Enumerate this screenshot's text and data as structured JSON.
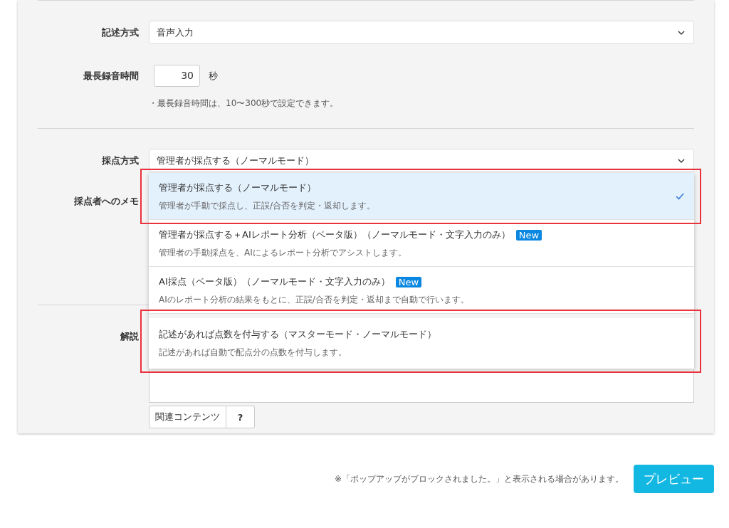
{
  "answer_format": {
    "label": "記述方式",
    "value": "音声入力"
  },
  "max_recording": {
    "label": "最長録音時間",
    "value": "30",
    "unit": "秒",
    "note": "・最長録音時間は、10〜300秒で設定できます。"
  },
  "grading_method": {
    "label": "採点方式",
    "value": "管理者が採点する（ノーマルモード）",
    "expanded": true,
    "options": [
      {
        "title": "管理者が採点する（ノーマルモード）",
        "description": "管理者が手動で採点し、正誤/合否を判定・返却します。",
        "selected": true,
        "highlighted": true
      },
      {
        "title": "管理者が採点する＋AIレポート分析（ベータ版）（ノーマルモード・文字入力のみ）",
        "description": "管理者の手動採点を、AIによるレポート分析でアシストします。",
        "badge": "New",
        "selected": false,
        "highlighted": false
      },
      {
        "title": "AI採点（ベータ版）（ノーマルモード・文字入力のみ）",
        "description": "AIのレポート分析の結果をもとに、正誤/合否を判定・返却まで自動で行います。",
        "badge": "New",
        "selected": false,
        "highlighted": false
      },
      {
        "title": "記述があれば点数を付与する（マスターモード・ノーマルモード）",
        "description": "記述があれば自動で配点分の点数を付与します。",
        "selected": false,
        "highlighted": true
      }
    ]
  },
  "grader_memo": {
    "label": "採点者へのメモ"
  },
  "explanation": {
    "label": "解説",
    "buttons": [
      "関連コンテンツ",
      "?"
    ]
  },
  "footer": {
    "note": "※「ポップアップがブロックされました。」と表示される場合があります。",
    "button": "プレビュー"
  }
}
